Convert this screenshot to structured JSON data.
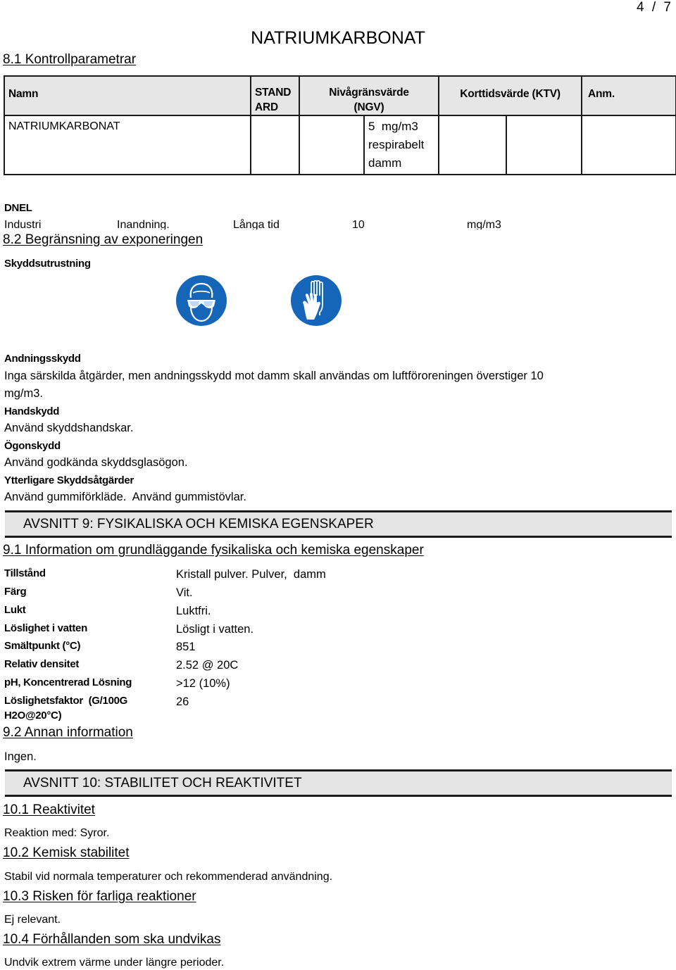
{
  "page": {
    "number": "4 / 7"
  },
  "document": {
    "title": "NATRIUMKARBONAT"
  },
  "section8": {
    "s81_heading": "8.1 Kontrollparametrar",
    "table": {
      "headers": {
        "name": "Namn",
        "standard": "STAND ARD",
        "standard_line1": "STAND",
        "standard_line2": "ARD",
        "ngv_line1": "Nivågränsvärde",
        "ngv_line2": "(NGV)",
        "ktv": "Korttidsvärde (KTV)",
        "anm": "Anm."
      },
      "rows": [
        {
          "name": "NATRIUMKARBONAT",
          "standard": "",
          "ngv_a": "",
          "ngv_b_line1": "5  mg/m3",
          "ngv_b_line2": "respirabelt",
          "ngv_b_line3": "damm",
          "ktv_a": "",
          "ktv_b": "",
          "anm": ""
        }
      ]
    },
    "dnel": {
      "label": "DNEL",
      "row": [
        "Industri",
        "Inandning.",
        "Långa tid",
        "10",
        "mg/m3"
      ]
    },
    "s82_heading": "8.2 Begränsning av exponeringen",
    "ppe_label": "Skyddsutrustning",
    "ppe_icons": [
      {
        "name": "eye-protection-icon",
        "color": "#1565b8"
      },
      {
        "name": "hand-protection-icon",
        "color": "#1565b8"
      }
    ],
    "respiratory": {
      "label": "Andningsskydd",
      "text_line1": "Inga särskilda åtgärder,  men andningsskydd mot damm skall användas om luftföroreningen överstiger 10",
      "text_line2": "mg/m3."
    },
    "hand": {
      "label": "Handskydd",
      "text": "Använd skyddshandskar."
    },
    "eye": {
      "label": "Ögonskydd",
      "text": "Använd godkända skyddsglasögon."
    },
    "additional": {
      "label": "Ytterligare Skyddsåtgärder",
      "text": "Använd gummiförkläde.  Använd gummistövlar."
    }
  },
  "section9": {
    "bar_title": "AVSNITT 9: FYSIKALISKA OCH KEMISKA EGENSKAPER",
    "s91_heading": "9.1 Information om grundläggande fysikaliska och kemiska egenskaper",
    "properties": [
      {
        "label": "Tillstånd",
        "value": "Kristall pulver. Pulver,  damm"
      },
      {
        "label": "Färg",
        "value": "Vit."
      },
      {
        "label": "Lukt",
        "value": "Luktfri."
      },
      {
        "label": "Löslighet i vatten",
        "value": "Lösligt i vatten."
      },
      {
        "label": "Smältpunkt (°C)",
        "value": "851"
      },
      {
        "label": "Relativ densitet",
        "value": "2.52 @ 20C"
      },
      {
        "label": "pH, Koncentrerad Lösning",
        "value": ">12 (10%)"
      },
      {
        "label": "Löslighetsfaktor  (G/100G",
        "label_line2": "H2O@20°C)",
        "value": "26"
      }
    ],
    "s92_heading": "9.2 Annan information",
    "s92_text": "Ingen."
  },
  "section10": {
    "bar_title": "AVSNITT 10: STABILITET OCH REAKTIVITET",
    "s101_heading": "10.1 Reaktivitet",
    "s101_text": "Reaktion med: Syror.",
    "s102_heading": "10.2 Kemisk stabilitet",
    "s102_text": "Stabil vid normala temperaturer och rekommenderad användning.",
    "s103_heading": "10.3 Risken för farliga reaktioner",
    "s103_text": "Ej relevant.",
    "s104_heading": "10.4 Förhållanden som ska undvikas",
    "s104_text": "Undvik extrem värme under längre perioder."
  }
}
